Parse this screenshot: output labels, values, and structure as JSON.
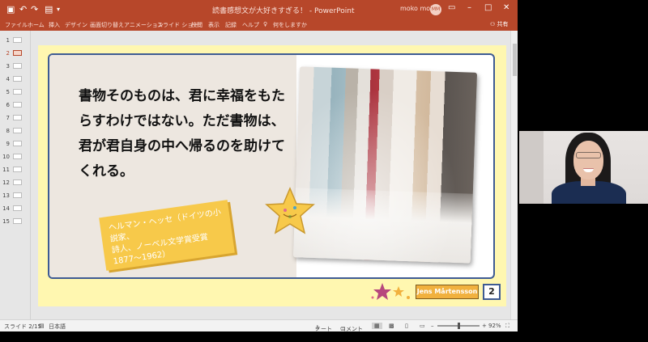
{
  "window": {
    "doc_title": "読書感想文が大好きすぎる！ - PowerPoint",
    "user_name": "moko moko",
    "user_initials": "MM",
    "qat_icons": [
      "save-icon",
      "undo-icon",
      "redo-icon",
      "present-icon",
      "customize-icon"
    ]
  },
  "ribbon": {
    "tabs": [
      "ファイル",
      "ホーム",
      "挿入",
      "デザイン",
      "画面切り替え",
      "アニメーション",
      "スライド ショー",
      "校閲",
      "表示",
      "記録",
      "ヘルプ",
      "何をしますか"
    ],
    "share_label": "共有"
  },
  "thumbnails": [
    "1",
    "2",
    "3",
    "4",
    "5",
    "6",
    "7",
    "8",
    "9",
    "10",
    "11",
    "12",
    "13",
    "14",
    "15"
  ],
  "active_slide": 2,
  "slide": {
    "quote": "書物そのものは、君に幸福をもたらすわけではない。ただ書物は、君が君自身の中へ帰るのを助けてくれる。",
    "attribution": "ヘルマン・ヘッセ（ドイツの小説家、\n詩人、ノーベル文学賞受賞\n1877〜1962）",
    "footer_name": "Jens Mårtensson",
    "page_number": "2"
  },
  "statusbar": {
    "slide_indicator": "スライド 2/15",
    "language": "日本語",
    "notes_label": "ノート",
    "comments_label": "コメント",
    "zoom": "92%"
  },
  "colors": {
    "title_bar": "#b7472a",
    "slide_background": "#fff7b0",
    "frame_border": "#3e5b93",
    "sticky_note": "#f7c94a"
  }
}
